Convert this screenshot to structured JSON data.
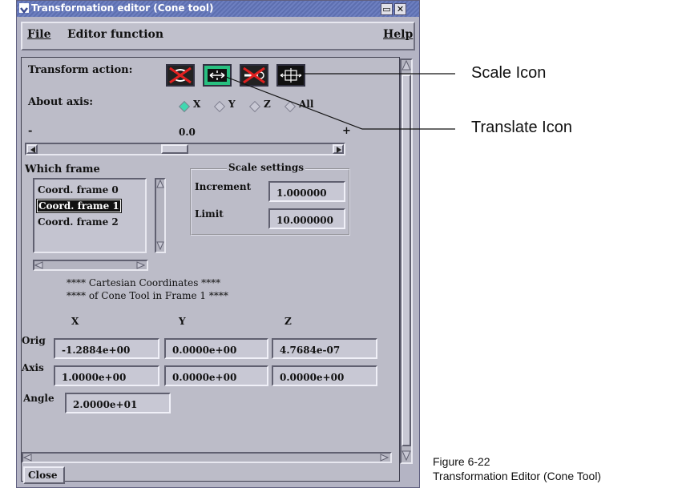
{
  "window": {
    "title": "Transformation editor (Cone tool)"
  },
  "menu": {
    "file": "File",
    "editor_function": "Editor function",
    "help": "Help"
  },
  "transform": {
    "label": "Transform action:",
    "buttons": [
      "rotate-icon",
      "translate-icon",
      "scale-x-icon",
      "scale-icon"
    ]
  },
  "axis": {
    "label": "About axis:",
    "options": [
      "X",
      "Y",
      "Z",
      "All"
    ],
    "selected": "X"
  },
  "slider": {
    "min_label": "-",
    "value": "0.0",
    "max_label": "+"
  },
  "frames": {
    "label": "Which frame",
    "items": [
      "Coord. frame 0",
      "Coord. frame 1",
      "Coord. frame 2"
    ],
    "selected_index": 1
  },
  "scale": {
    "title": "Scale settings",
    "increment_label": "Increment",
    "increment_value": "1.000000",
    "limit_label": "Limit",
    "limit_value": "10.000000"
  },
  "coords": {
    "heading1": "**** Cartesian Coordinates ****",
    "heading2": "**** of Cone Tool in Frame 1 ****",
    "cols": [
      "X",
      "Y",
      "Z"
    ],
    "orig_label": "Orig",
    "orig": [
      "-1.2884e+00",
      "0.0000e+00",
      "4.7684e-07"
    ],
    "axis_label": "Axis",
    "axis": [
      "1.0000e+00",
      "0.0000e+00",
      "0.0000e+00"
    ],
    "angle_label": "Angle",
    "angle": "2.0000e+01"
  },
  "close_label": "Close",
  "callouts": {
    "scale": "Scale Icon",
    "translate": "Translate Icon"
  },
  "caption": {
    "line1": "Figure 6-22",
    "line2": "Transformation Editor (Cone Tool)"
  }
}
